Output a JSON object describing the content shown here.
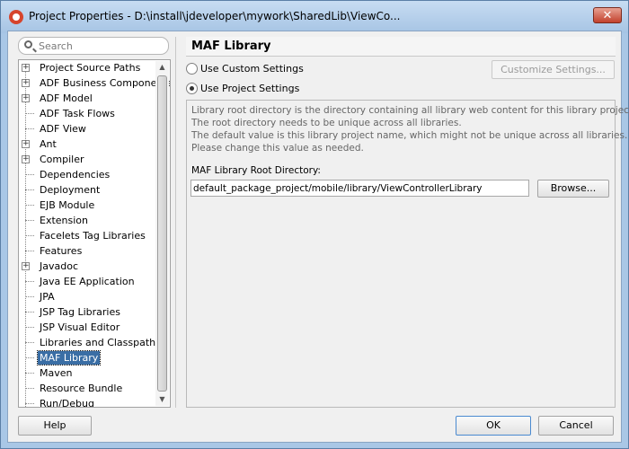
{
  "window": {
    "title": "Project Properties - D:\\install\\jdeveloper\\mywork\\SharedLib\\ViewCo...",
    "close_label": "✕"
  },
  "search": {
    "placeholder": "Search"
  },
  "tree": {
    "items": [
      {
        "label": "Project Source Paths",
        "expandable": true
      },
      {
        "label": "ADF Business Components",
        "expandable": true
      },
      {
        "label": "ADF Model",
        "expandable": true
      },
      {
        "label": "ADF Task Flows",
        "expandable": false
      },
      {
        "label": "ADF View",
        "expandable": false
      },
      {
        "label": "Ant",
        "expandable": true
      },
      {
        "label": "Compiler",
        "expandable": true
      },
      {
        "label": "Dependencies",
        "expandable": false
      },
      {
        "label": "Deployment",
        "expandable": false
      },
      {
        "label": "EJB Module",
        "expandable": false
      },
      {
        "label": "Extension",
        "expandable": false
      },
      {
        "label": "Facelets Tag Libraries",
        "expandable": false
      },
      {
        "label": "Features",
        "expandable": false
      },
      {
        "label": "Javadoc",
        "expandable": true
      },
      {
        "label": "Java EE Application",
        "expandable": false
      },
      {
        "label": "JPA",
        "expandable": false
      },
      {
        "label": "JSP Tag Libraries",
        "expandable": false
      },
      {
        "label": "JSP Visual Editor",
        "expandable": false
      },
      {
        "label": "Libraries and Classpath",
        "expandable": false
      },
      {
        "label": "MAF Library",
        "expandable": false,
        "selected": true
      },
      {
        "label": "Maven",
        "expandable": false
      },
      {
        "label": "Resource Bundle",
        "expandable": false
      },
      {
        "label": "Run/Debug",
        "expandable": false
      }
    ]
  },
  "panel": {
    "title": "MAF Library",
    "use_custom_label": "Use Custom Settings",
    "use_project_label": "Use Project Settings",
    "customize_label": "Customize Settings...",
    "selected_option": "Use Project Settings",
    "description": [
      "Library root directory is the directory containing all library web content for this library project.",
      "The root directory needs to be unique across all libraries.",
      "The default value is this library project name, which might not be unique across all libraries.",
      "Please change this value as needed."
    ],
    "root_dir_label": "MAF Library Root Directory:",
    "root_dir_value": "default_package_project/mobile/library/ViewControllerLibrary",
    "browse_label": "Browse..."
  },
  "footer": {
    "help_label": "Help",
    "ok_label": "OK",
    "cancel_label": "Cancel"
  }
}
